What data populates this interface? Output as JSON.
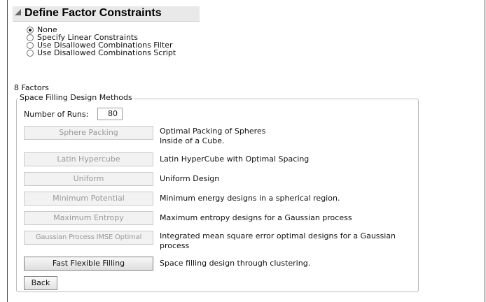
{
  "outline": {
    "title": "Define Factor Constraints",
    "options": [
      {
        "label": "None",
        "selected": true
      },
      {
        "label": "Specify Linear Constraints",
        "selected": false
      },
      {
        "label": "Use Disallowed Combinations Filter",
        "selected": false
      },
      {
        "label": "Use Disallowed Combinations Script",
        "selected": false
      }
    ]
  },
  "factors_count": "8 Factors",
  "methods_panel": {
    "title": "Space Filling Design Methods",
    "runs_label": "Number of Runs:",
    "runs_value": "80",
    "methods": [
      {
        "label": "Sphere Packing",
        "description": "Optimal Packing of Spheres\nInside of a Cube.",
        "enabled": false
      },
      {
        "label": "Latin Hypercube",
        "description": "Latin HyperCube with Optimal Spacing",
        "enabled": false
      },
      {
        "label": "Uniform",
        "description": "Uniform Design",
        "enabled": false
      },
      {
        "label": "Minimum Potential",
        "description": "Minimum energy designs in a spherical region.",
        "enabled": false
      },
      {
        "label": "Maximum Entropy",
        "description": "Maximum entropy designs for a Gaussian process",
        "enabled": false
      },
      {
        "label": "Gaussian Process IMSE Optimal",
        "description": "Integrated mean square error optimal designs for a Gaussian process",
        "enabled": false
      },
      {
        "label": "Fast Flexible Filling",
        "description": "Space filling design through clustering.",
        "enabled": true
      }
    ],
    "back_label": "Back"
  },
  "colors": {
    "header_bg": "#e9e9e9",
    "disabled_text": "#9a9a9a",
    "border": "#4a4a4a"
  }
}
